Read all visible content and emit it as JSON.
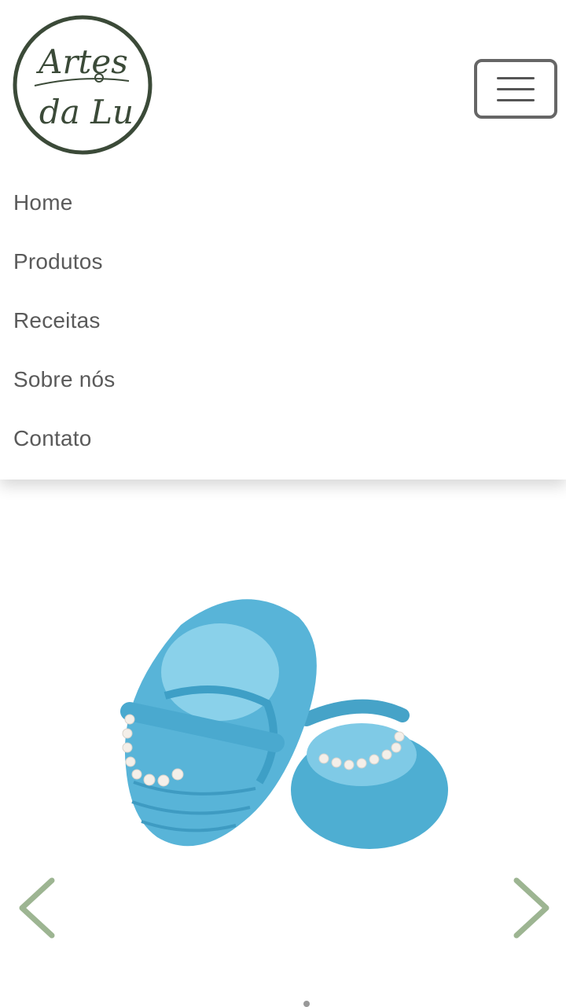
{
  "brand": {
    "logo_line1": "Artes",
    "logo_line2": "da Lu",
    "ink_color": "#3b4a38"
  },
  "nav": {
    "items": [
      {
        "label": "Home"
      },
      {
        "label": "Produtos"
      },
      {
        "label": "Receitas"
      },
      {
        "label": "Sobre nós"
      },
      {
        "label": "Contato"
      }
    ]
  },
  "carousel": {
    "product": "crochet baby shoes",
    "product_color": "#59b5d6",
    "arrow_color": "#9db592"
  },
  "icons": {
    "menu": "hamburger-icon",
    "prev": "chevron-left-icon",
    "next": "chevron-right-icon"
  }
}
